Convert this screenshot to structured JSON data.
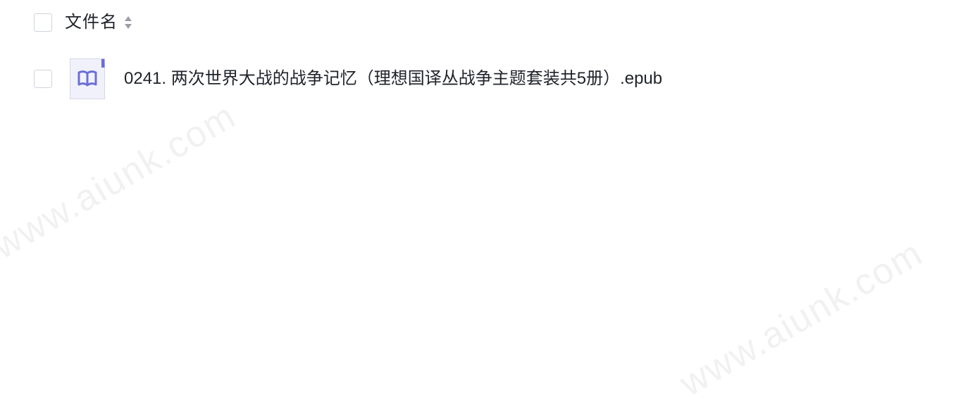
{
  "table": {
    "header": {
      "filename_label": "文件名"
    },
    "rows": [
      {
        "name": "0241. 两次世界大战的战争记忆（理想国译丛战争主题套装共5册）.epub",
        "icon": "epub-book-icon"
      }
    ]
  },
  "watermark": {
    "text": "www.aiunk.com"
  },
  "colors": {
    "icon_accent": "#6b6fd6",
    "icon_background": "#f1f1fb",
    "checkbox_border": "#cfd3d9",
    "text": "#1f2329",
    "watermark": "#787882"
  }
}
